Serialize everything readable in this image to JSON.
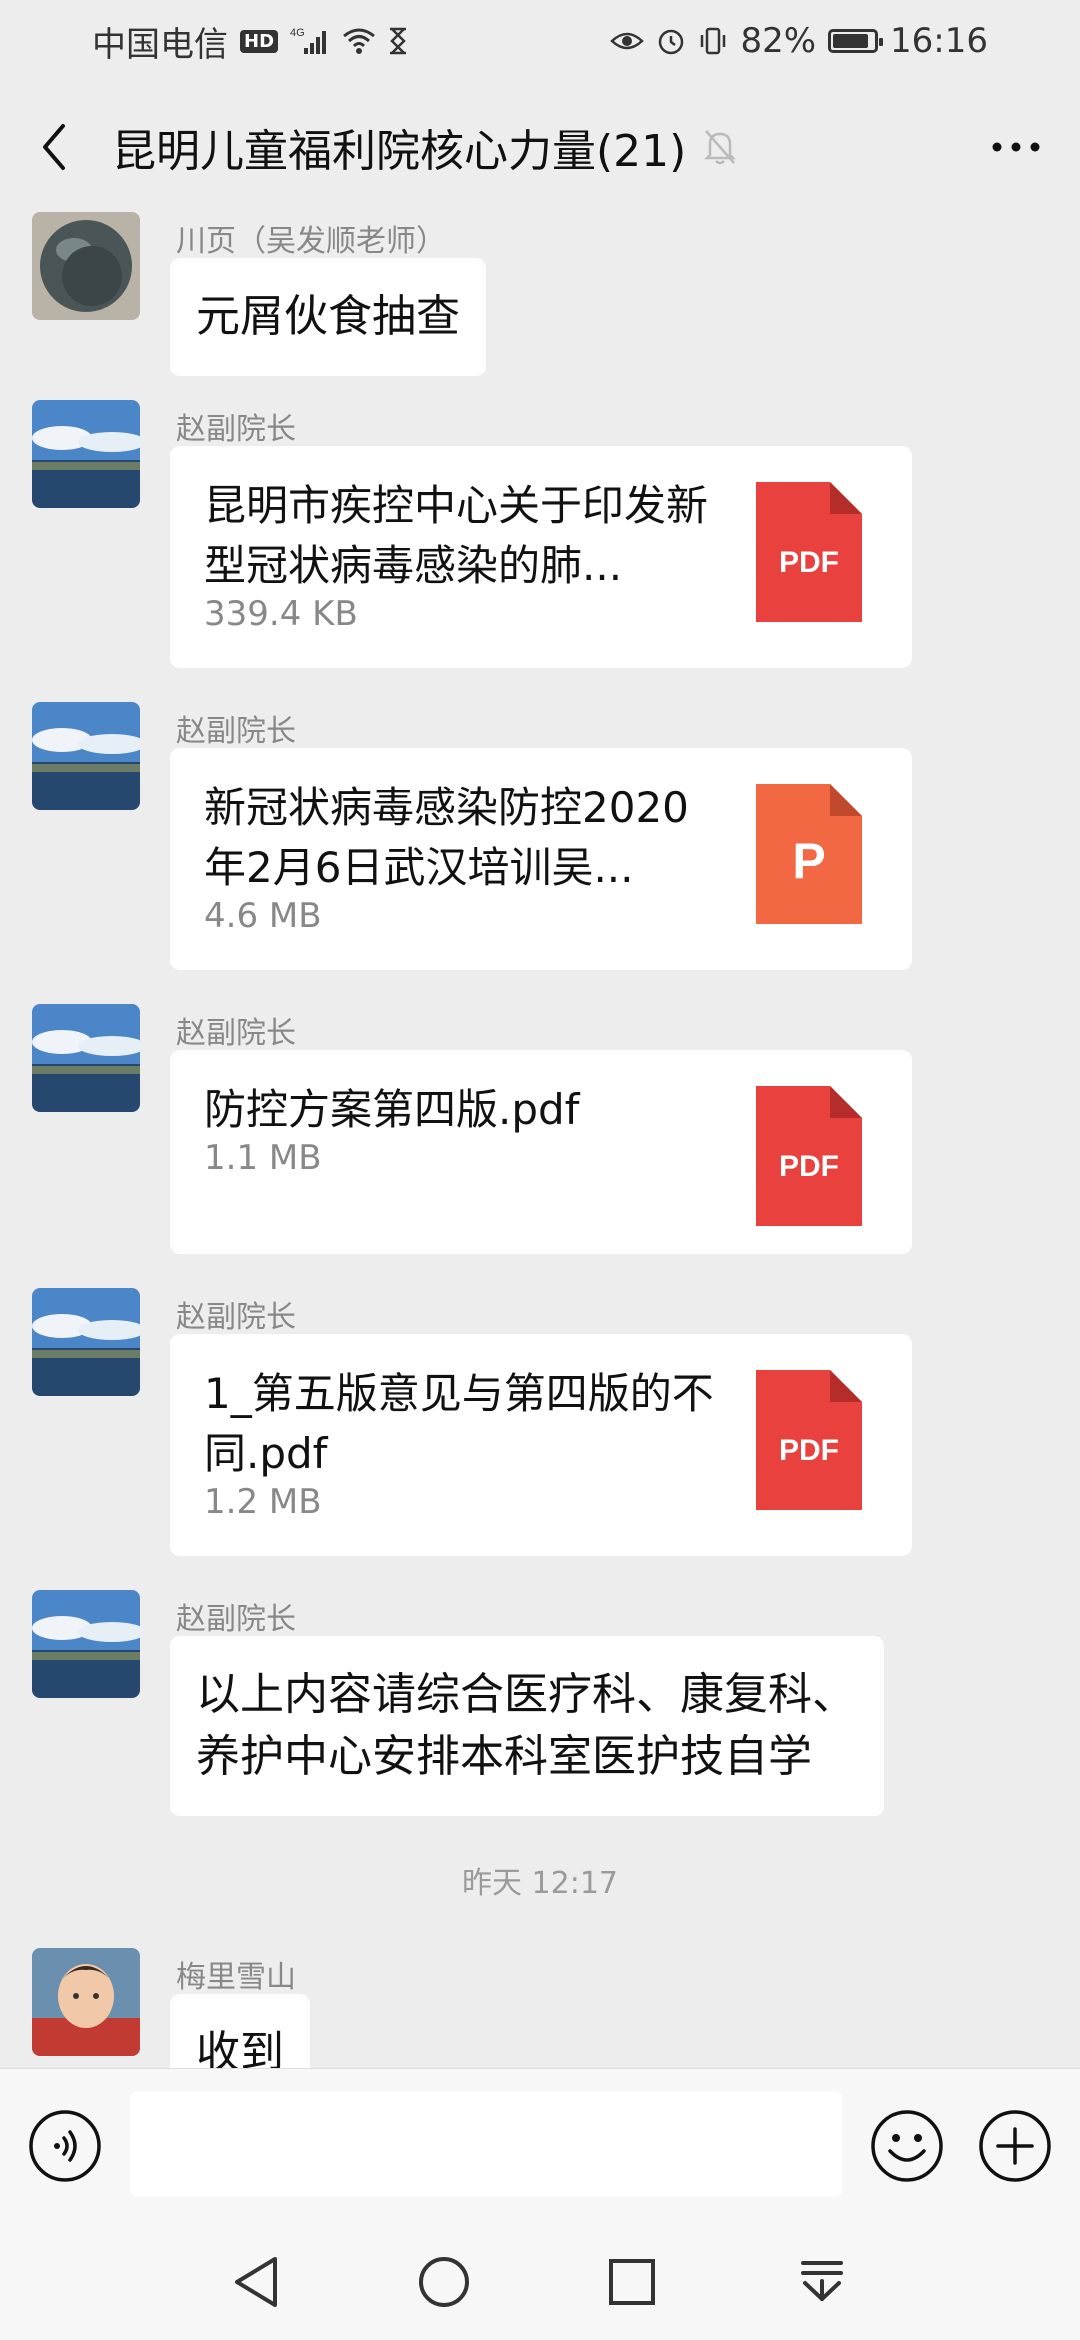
{
  "status_bar": {
    "carrier": "中国电信",
    "hd": "HD",
    "network": "4G",
    "battery": "82%",
    "time": "16:16"
  },
  "header": {
    "title": "昆明儿童福利院核心力量(21)"
  },
  "messages": [
    {
      "sender": "川页（吴发顺老师）",
      "type": "text",
      "text": "元屑伙食抽查"
    },
    {
      "sender": "赵副院长",
      "type": "file",
      "name": "昆明市疾控中心关于印发新型冠状病毒感染的肺...",
      "size": "339.4 KB",
      "file_type": "pdf",
      "icon_label": "PDF"
    },
    {
      "sender": "赵副院长",
      "type": "file",
      "name": "新冠状病毒感染防控2020年2月6日武汉培训吴...",
      "size": "4.6 MB",
      "file_type": "ppt",
      "icon_label": "P"
    },
    {
      "sender": "赵副院长",
      "type": "file",
      "name": "防控方案第四版.pdf",
      "size": "1.1 MB",
      "file_type": "pdf",
      "icon_label": "PDF"
    },
    {
      "sender": "赵副院长",
      "type": "file",
      "name": "1_第五版意见与第四版的不同.pdf",
      "size": "1.2 MB",
      "file_type": "pdf",
      "icon_label": "PDF"
    },
    {
      "sender": "赵副院长",
      "type": "text",
      "text": "以上内容请综合医疗科、康复科、养护中心安排本科室医护技自学"
    },
    {
      "sender": "梅里雪山",
      "type": "text",
      "text": "收到"
    }
  ],
  "timestamp": "昨天 12:17",
  "colors": {
    "pdf": "#e8413e",
    "ppt": "#f26843",
    "background": "#ededed"
  },
  "icons": {
    "back": "chevron-left-icon",
    "mute": "bell-off-icon",
    "more": "more-dots-icon",
    "voice": "voice-icon",
    "emoji": "emoji-icon",
    "plus": "plus-circle-icon"
  }
}
